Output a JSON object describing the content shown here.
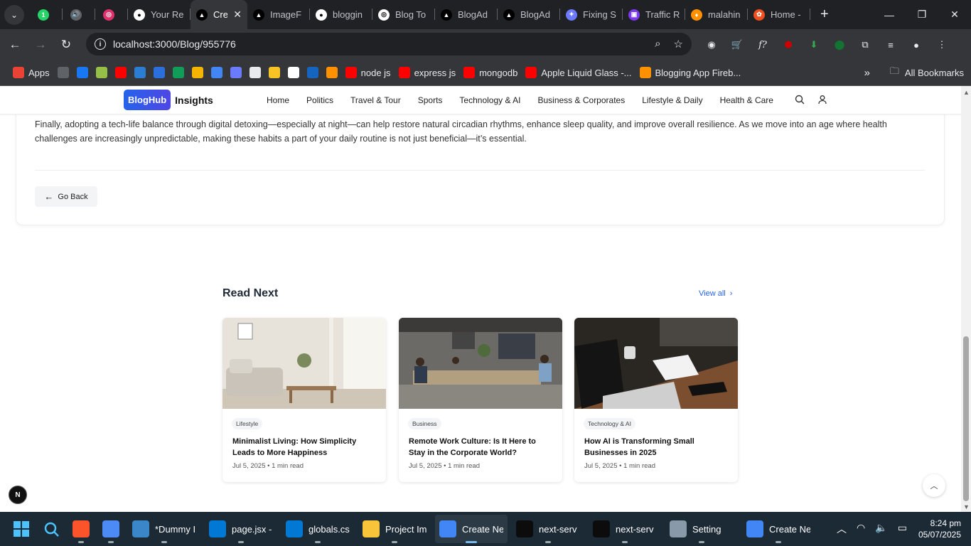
{
  "browser": {
    "tabs": [
      {
        "label": "",
        "color": "#25d366",
        "glyph": "1"
      },
      {
        "label": "",
        "color": "#5f6368",
        "glyph": "🔊"
      },
      {
        "label": "",
        "color": "#e1306c",
        "glyph": "◎"
      },
      {
        "label": "Your Re",
        "color": "#ffffff",
        "glyph": "●"
      },
      {
        "label": "Cre",
        "color": "#000000",
        "glyph": "▲",
        "active": true
      },
      {
        "label": "ImageF",
        "color": "#000000",
        "glyph": "▲"
      },
      {
        "label": "bloggin",
        "color": "#ffffff",
        "glyph": "●"
      },
      {
        "label": "Blog To",
        "color": "#ffffff",
        "glyph": "◎"
      },
      {
        "label": "BlogAd",
        "color": "#000000",
        "glyph": "▲"
      },
      {
        "label": "BlogAd",
        "color": "#000000",
        "glyph": "▲"
      },
      {
        "label": "Fixing S",
        "color": "#6b7bff",
        "glyph": "✦"
      },
      {
        "label": "Traffic R",
        "color": "#7c3aed",
        "glyph": "▣"
      },
      {
        "label": "malahin",
        "color": "#ff9100",
        "glyph": "♦"
      },
      {
        "label": "Home -",
        "color": "#f24e1e",
        "glyph": "✿"
      }
    ],
    "url": "localhost:3000/Blog/955776",
    "bookmarks": [
      {
        "label": "Apps",
        "color": "#ea4335"
      },
      {
        "label": "",
        "color": "#5f6368"
      },
      {
        "label": "",
        "color": "#1877f2"
      },
      {
        "label": "",
        "color": "#96bf48"
      },
      {
        "label": "",
        "color": "#ff0000"
      },
      {
        "label": "",
        "color": "#2b7cd3"
      },
      {
        "label": "",
        "color": "#2a6fdb"
      },
      {
        "label": "",
        "color": "#0f9d58"
      },
      {
        "label": "",
        "color": "#f4b400"
      },
      {
        "label": "",
        "color": "#4285f4"
      },
      {
        "label": "",
        "color": "#6b7bff"
      },
      {
        "label": "",
        "color": "#e8eaed"
      },
      {
        "label": "",
        "color": "#f7c325"
      },
      {
        "label": "",
        "color": "#ffffff"
      },
      {
        "label": "",
        "color": "#1565c0"
      },
      {
        "label": "",
        "color": "#ff9100"
      },
      {
        "label": "node js",
        "color": "#ff0000"
      },
      {
        "label": "express js",
        "color": "#ff0000"
      },
      {
        "label": "mongodb",
        "color": "#ff0000"
      },
      {
        "label": "Apple Liquid Glass -...",
        "color": "#ff0000"
      },
      {
        "label": "Blogging App Fireb...",
        "color": "#ff9100"
      }
    ],
    "all_bookmarks": "All Bookmarks"
  },
  "site": {
    "logo_badge": "BlogHub",
    "logo_text": "Insights",
    "nav": [
      "Home",
      "Politics",
      "Travel & Tour",
      "Sports",
      "Technology & AI",
      "Business & Corporates",
      "Lifestyle & Daily",
      "Health & Care"
    ]
  },
  "article": {
    "paragraph": "Finally, adopting a tech-life balance through digital detoxing—especially at night—can help restore natural circadian rhythms, enhance sleep quality, and improve overall resilience. As we move into an age where health challenges are increasingly unpredictable, making these habits a part of your daily routine is not just beneficial—it’s essential.",
    "go_back": "Go Back"
  },
  "read_next": {
    "title": "Read Next",
    "view_all": "View all",
    "posts": [
      {
        "category": "Lifestyle",
        "title": "Minimalist Living: How Simplicity Leads to More Happiness",
        "date": "Jul 5, 2025",
        "read": "1 min read"
      },
      {
        "category": "Business",
        "title": "Remote Work Culture: Is It Here to Stay in the Corporate World?",
        "date": "Jul 5, 2025",
        "read": "1 min read"
      },
      {
        "category": "Technology & AI",
        "title": "How AI is Transforming Small Businesses in 2025",
        "date": "Jul 5, 2025",
        "read": "1 min read"
      }
    ],
    "separator": "•"
  },
  "next_badge": "N",
  "taskbar": {
    "apps": [
      {
        "label": "",
        "color": "#fb542b"
      },
      {
        "label": "",
        "color": "#4c8bf5"
      },
      {
        "label": "*Dummy I",
        "color": "#3a86c8"
      },
      {
        "label": "page.jsx -",
        "color": "#0078d4"
      },
      {
        "label": "globals.cs",
        "color": "#0078d4"
      },
      {
        "label": "Project Im",
        "color": "#f8c43a"
      },
      {
        "label": "Create Ne",
        "color": "#4285f4",
        "active": true
      },
      {
        "label": "next-serv",
        "color": "#0c0c0c"
      },
      {
        "label": "next-serv",
        "color": "#0c0c0c"
      },
      {
        "label": "Setting",
        "color": "#8899aa"
      },
      {
        "label": "Create Ne",
        "color": "#4285f4"
      }
    ],
    "time": "8:24 pm",
    "date": "05/07/2025"
  }
}
